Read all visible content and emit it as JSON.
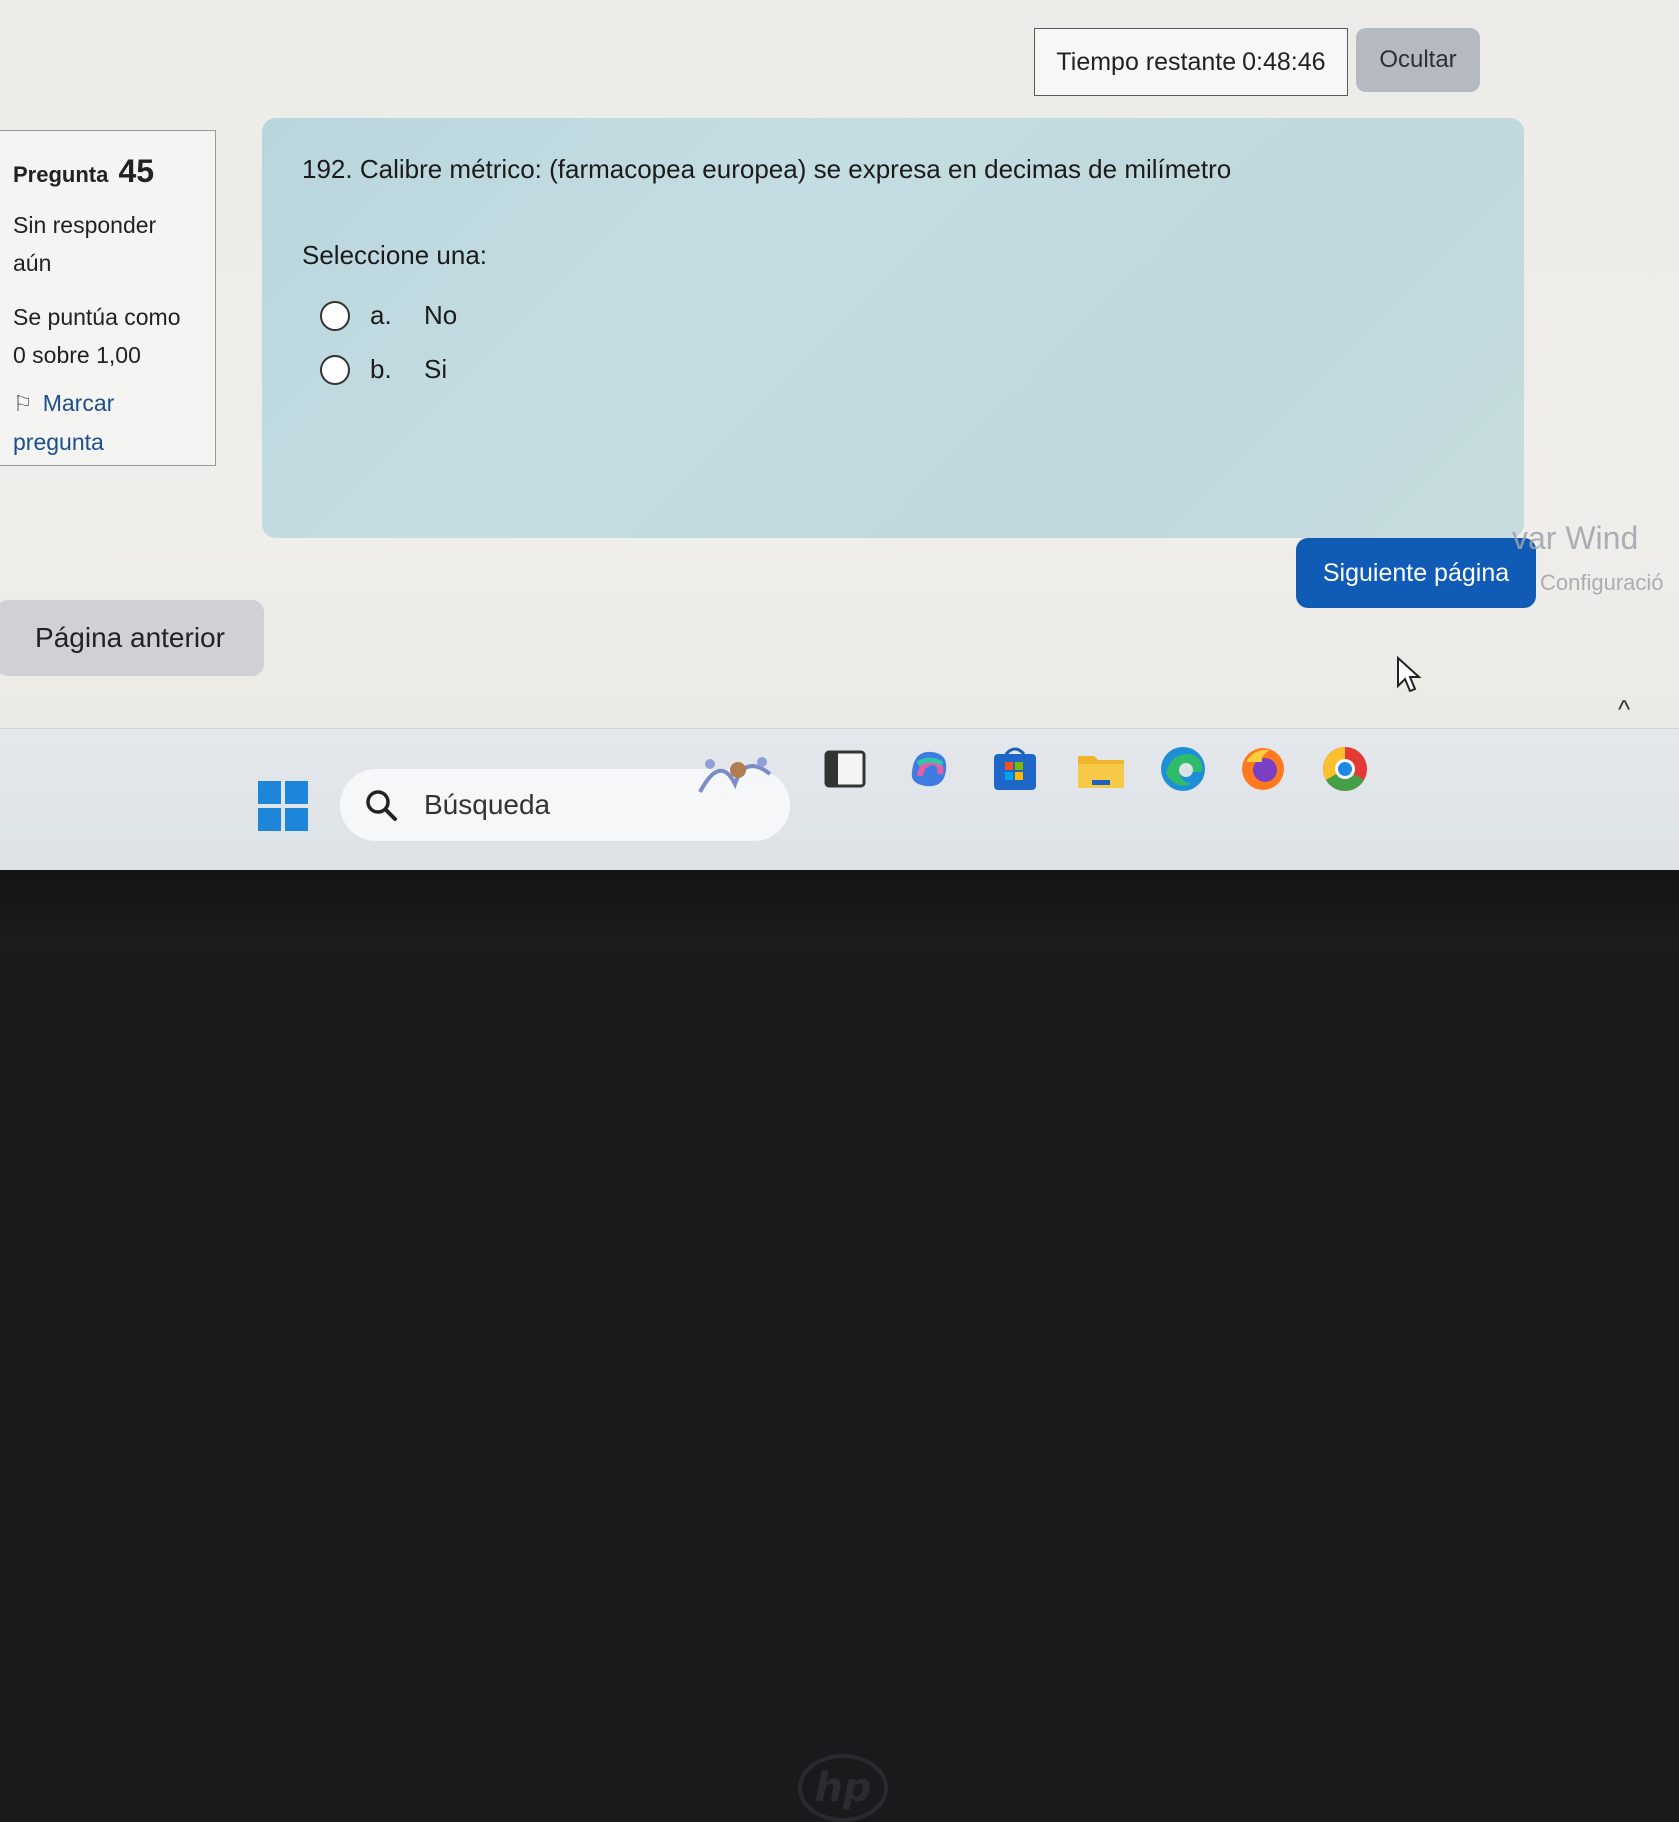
{
  "timer": {
    "label": "Tiempo restante",
    "value": "0:48:46"
  },
  "hide_button": "Ocultar",
  "question_info": {
    "label": "Pregunta",
    "number": "45",
    "status_line1": "Sin responder",
    "status_line2": "aún",
    "grade_line1": "Se puntúa como",
    "grade_line2": "0 sobre 1,00",
    "flag_line1": "Marcar",
    "flag_line2": "pregunta"
  },
  "question": {
    "text": "192. Calibre métrico: (farmacopea europea) se expresa en decimas de milímetro",
    "prompt": "Seleccione una:",
    "options": [
      {
        "letter": "a.",
        "label": "No"
      },
      {
        "letter": "b.",
        "label": "Si"
      }
    ]
  },
  "navigation": {
    "next": "Siguiente página",
    "previous": "Página anterior"
  },
  "watermark": {
    "line1": "var Wind",
    "line2": "Configuració"
  },
  "taskbar": {
    "search_placeholder": "Búsqueda"
  },
  "colors": {
    "accent": "#0f5bb5",
    "question_bg": "#c0d9de",
    "link": "#1d4f8c"
  }
}
